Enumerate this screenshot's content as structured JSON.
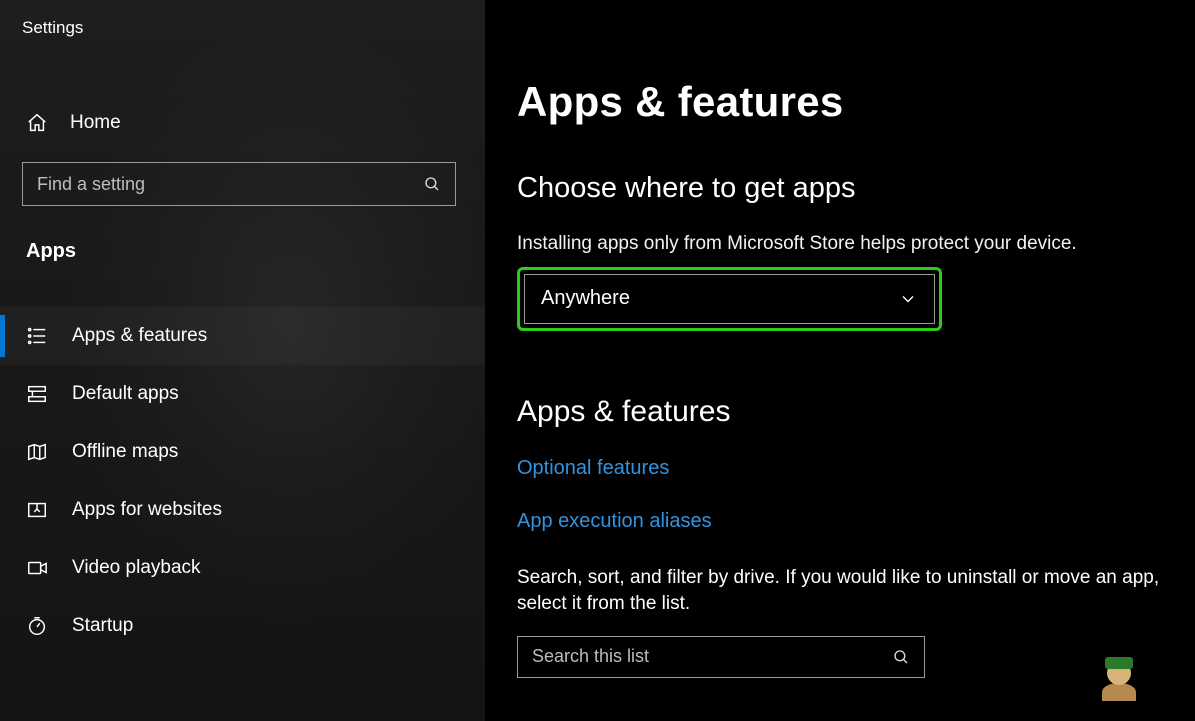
{
  "window": {
    "title": "Settings"
  },
  "sidebar": {
    "home_label": "Home",
    "search_placeholder": "Find a setting",
    "section_label": "Apps",
    "items": [
      {
        "label": "Apps & features",
        "icon": "list-icon",
        "active": true
      },
      {
        "label": "Default apps",
        "icon": "defaults-icon",
        "active": false
      },
      {
        "label": "Offline maps",
        "icon": "map-icon",
        "active": false
      },
      {
        "label": "Apps for websites",
        "icon": "websites-icon",
        "active": false
      },
      {
        "label": "Video playback",
        "icon": "video-icon",
        "active": false
      },
      {
        "label": "Startup",
        "icon": "startup-icon",
        "active": false
      }
    ]
  },
  "main": {
    "title": "Apps & features",
    "choose": {
      "heading": "Choose where to get apps",
      "help": "Installing apps only from Microsoft Store helps protect your device.",
      "dropdown_value": "Anywhere"
    },
    "features": {
      "heading": "Apps & features",
      "link_optional": "Optional features",
      "link_aliases": "App execution aliases",
      "help": "Search, sort, and filter by drive. If you would like to uninstall or move an app, select it from the list.",
      "search_placeholder": "Search this list"
    }
  },
  "colors": {
    "accent": "#0078d4",
    "link": "#3393df",
    "highlight": "#2ecc1a"
  }
}
